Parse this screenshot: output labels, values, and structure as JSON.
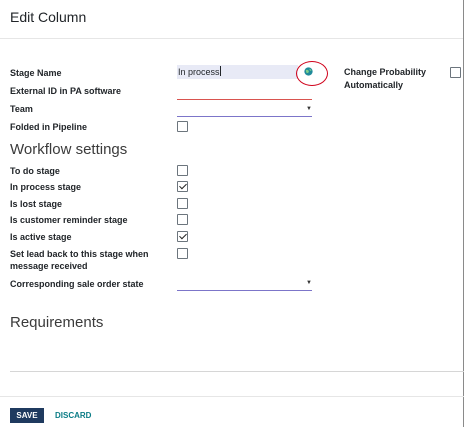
{
  "dialog": {
    "title": "Edit Column"
  },
  "fields": {
    "stage_name": {
      "label": "Stage Name",
      "value": "In process"
    },
    "external_id": {
      "label": "External ID in PA software"
    },
    "team": {
      "label": "Team"
    },
    "folded": {
      "label": "Folded in Pipeline",
      "checked": false
    },
    "change_probability": {
      "label_line1": "Change Probability",
      "label_line2": "Automatically",
      "checked": false
    }
  },
  "workflow": {
    "title": "Workflow settings",
    "items": [
      {
        "label": "To do stage",
        "checked": false
      },
      {
        "label": "In process stage",
        "checked": true
      },
      {
        "label": "Is lost stage",
        "checked": false
      },
      {
        "label": "Is customer reminder stage",
        "checked": false
      },
      {
        "label": "Is active stage",
        "checked": true
      },
      {
        "label_line1": "Set lead back to this stage when",
        "label_line2": "message received",
        "checked": false
      }
    ],
    "sale_order": {
      "label": "Corresponding sale order state"
    }
  },
  "requirements": {
    "title": "Requirements"
  },
  "footer": {
    "save_label": "SAVE",
    "discard_label": "DISCARD"
  },
  "icons": {
    "translate": "globe-icon",
    "dropdown": "caret-down-icon"
  },
  "colors": {
    "primary": "#1f3a5f",
    "link": "#0a7c86",
    "required_underline": "#d9534f",
    "focus_underline": "#7c75c9",
    "input_bg": "#e8eaf6",
    "annotation_circle": "#d0021b"
  }
}
